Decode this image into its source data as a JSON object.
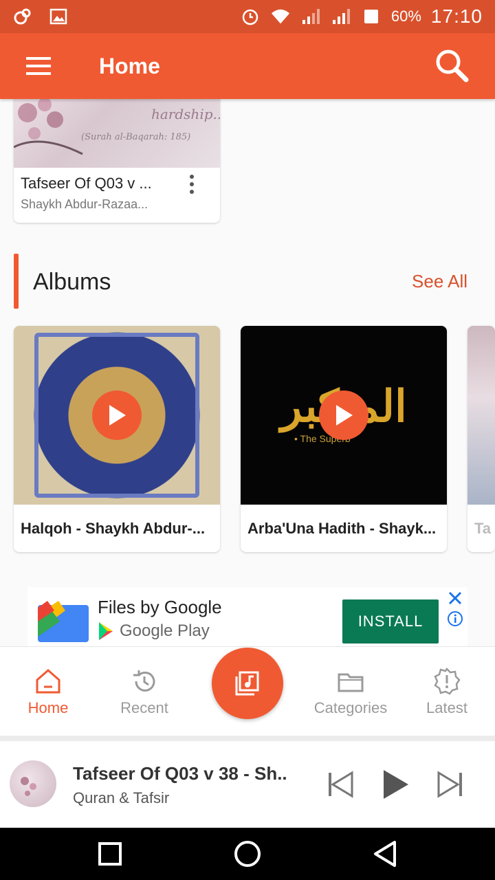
{
  "status_bar": {
    "battery": "60%",
    "time": "17:10"
  },
  "app_bar": {
    "title": "Home"
  },
  "recent_track": {
    "title": "Tafseer Of Q03 v ...",
    "subtitle": "Shaykh Abdur-Razaa...",
    "image_text_1": "hardship..",
    "image_text_2": "(Surah al-Baqarah: 185)"
  },
  "albums_section": {
    "title": "Albums",
    "see_all": "See All",
    "items": [
      {
        "title": "Halqoh - Shaykh Abdur-..."
      },
      {
        "title": "Arba'Una Hadith - Shayk..."
      },
      {
        "title": "Ta"
      }
    ],
    "album2_sub": "• The Superb"
  },
  "ad": {
    "title": "Files by Google",
    "store": "Google Play",
    "install": "INSTALL"
  },
  "bottom_nav": {
    "items": [
      {
        "label": "Home"
      },
      {
        "label": "Recent"
      },
      {
        "label": "Categories"
      },
      {
        "label": "Latest"
      }
    ]
  },
  "player": {
    "title": "Tafseer Of Q03 v 38 - Sh..",
    "subtitle": "Quran & Tafsir"
  },
  "colors": {
    "primary": "#f05a32",
    "status_bar": "#d9512c",
    "install": "#0a7a54"
  }
}
